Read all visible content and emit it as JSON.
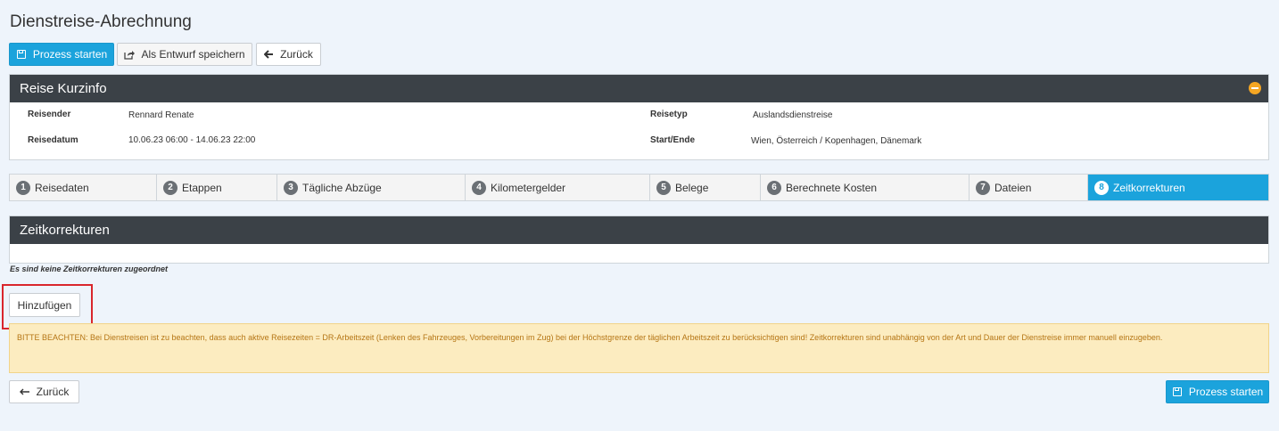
{
  "page": {
    "title": "Dienstreise-Abrechnung"
  },
  "toolbar": {
    "start_label": "Prozess starten",
    "draft_label": "Als Entwurf speichern",
    "back_label": "Zurück"
  },
  "trip_info": {
    "title": "Reise Kurzinfo",
    "fields": [
      {
        "label": "Reisender",
        "value": "Rennard Renate"
      },
      {
        "label": "Reisedatum",
        "value": "10.06.23 06:00 - 14.06.23 22:00"
      },
      {
        "label": "Reisetyp",
        "value": "Auslandsdienstreise"
      },
      {
        "label": "Start/Ende",
        "value": "Wien, Österreich / Kopenhagen, Dänemark"
      }
    ]
  },
  "tabs": [
    {
      "num": "1",
      "label": "Reisedaten"
    },
    {
      "num": "2",
      "label": "Etappen"
    },
    {
      "num": "3",
      "label": "Tägliche Abzüge"
    },
    {
      "num": "4",
      "label": "Kilometergelder"
    },
    {
      "num": "5",
      "label": "Belege"
    },
    {
      "num": "6",
      "label": "Berechnete Kosten"
    },
    {
      "num": "7",
      "label": "Dateien"
    },
    {
      "num": "8",
      "label": "Zeitkorrekturen"
    }
  ],
  "active_tab": "8",
  "corrections": {
    "title": "Zeitkorrekturen",
    "empty_text": "Es sind keine Zeitkorrekturen zugeordnet",
    "add_label": "Hinzufügen",
    "notice": "BITTE BEACHTEN: Bei Dienstreisen ist zu beachten, dass auch aktive Reisezeiten = DR-Arbeitszeit (Lenken des Fahrzeuges, Vorbereitungen im Zug) bei der Höchstgrenze der täglichen Arbeitszeit zu berücksichtigen sind! Zeitkorrekturen sind unabhängig von der Art und Dauer der Dienstreise immer manuell einzugeben."
  },
  "footer": {
    "back_label": "Zurück",
    "start_label": "Prozess starten"
  },
  "colors": {
    "primary": "#1ba3dc",
    "panel_header": "#3b4147",
    "warning_bg": "#fcecc0",
    "warning_text": "#b57514",
    "highlight": "#d9262c",
    "collapse": "#f5a623"
  },
  "icons": {
    "start": "save-icon",
    "draft": "share-icon",
    "back": "arrow-left-icon",
    "collapse": "minus-circle-icon"
  }
}
